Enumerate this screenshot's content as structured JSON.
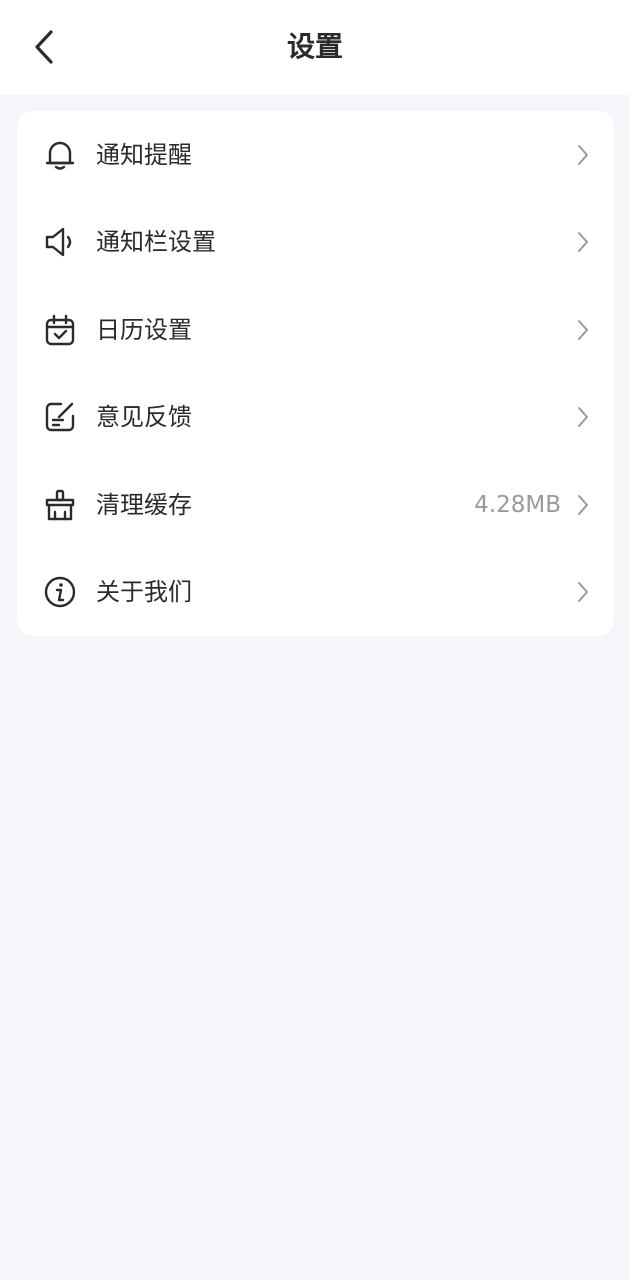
{
  "header": {
    "title": "设置",
    "back_icon": "chevron-left-icon"
  },
  "settings": {
    "items": [
      {
        "label": "通知提醒",
        "icon": "bell-icon",
        "value": ""
      },
      {
        "label": "通知栏设置",
        "icon": "speaker-icon",
        "value": ""
      },
      {
        "label": "日历设置",
        "icon": "calendar-icon",
        "value": ""
      },
      {
        "label": "意见反馈",
        "icon": "feedback-icon",
        "value": ""
      },
      {
        "label": "清理缓存",
        "icon": "broom-icon",
        "value": "4.28MB"
      },
      {
        "label": "关于我们",
        "icon": "info-icon",
        "value": ""
      }
    ]
  },
  "colors": {
    "background": "#f4f6fa",
    "card": "#ffffff",
    "text": "#2b2b2b",
    "secondary_text": "#9a9a9a",
    "chevron": "#999999"
  }
}
